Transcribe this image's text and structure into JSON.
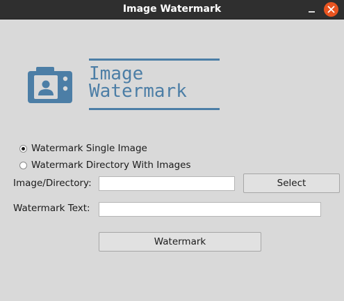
{
  "window": {
    "title": "Image Watermark"
  },
  "logo": {
    "line1": "Image",
    "line2": "Watermark",
    "icon": "camera-icon",
    "color": "#4c7ea6"
  },
  "mode": {
    "options": [
      {
        "label": "Watermark Single Image",
        "checked": true
      },
      {
        "label": "Watermark Directory With Images",
        "checked": false
      }
    ]
  },
  "form": {
    "image_directory_label": "Image/Directory:",
    "image_directory_value": "",
    "watermark_text_label": "Watermark Text:",
    "watermark_text_value": "",
    "select_button": "Select",
    "watermark_button": "Watermark"
  },
  "colors": {
    "window_bg": "#d9d9d9",
    "titlebar_bg": "#2f2f2f",
    "close_button": "#e95420"
  }
}
